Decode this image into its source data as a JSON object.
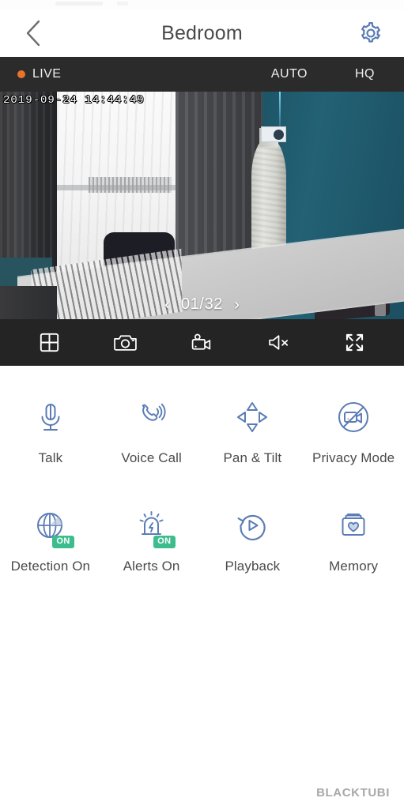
{
  "navbar": {
    "title": "Bedroom",
    "back_icon": "chevron-left-icon",
    "settings_icon": "gear-icon"
  },
  "live_bar": {
    "live_label": "LIVE",
    "status_dot_color": "#e8732a",
    "auto_label": "AUTO",
    "hq_label": "HQ"
  },
  "video": {
    "timestamp": "2019-09-24 14:44:49",
    "pager_prev": "‹",
    "pager_text": "01/32",
    "pager_next": "›"
  },
  "control_bar": {
    "items": [
      {
        "name": "grid-view-icon"
      },
      {
        "name": "snapshot-camera-icon"
      },
      {
        "name": "record-video-icon"
      },
      {
        "name": "speaker-muted-icon"
      },
      {
        "name": "fullscreen-icon"
      }
    ]
  },
  "functions": {
    "row1": [
      {
        "label": "Talk",
        "icon": "microphone-icon",
        "badge": null
      },
      {
        "label": "Voice Call",
        "icon": "phone-call-icon",
        "badge": null
      },
      {
        "label": "Pan & Tilt",
        "icon": "pan-tilt-icon",
        "badge": null
      },
      {
        "label": "Privacy Mode",
        "icon": "camera-off-icon",
        "badge": null
      }
    ],
    "row2": [
      {
        "label": "Detection On",
        "icon": "motion-detection-icon",
        "badge": "ON"
      },
      {
        "label": "Alerts On",
        "icon": "alarm-siren-icon",
        "badge": "ON"
      },
      {
        "label": "Playback",
        "icon": "playback-replay-icon",
        "badge": null
      },
      {
        "label": "Memory",
        "icon": "memory-box-icon",
        "badge": null
      }
    ]
  },
  "colors": {
    "accent_blue": "#5b7cb5",
    "badge_green": "#3dbd8e",
    "live_orange": "#e8732a",
    "bar_dark": "#2b2b2b"
  },
  "watermark": {
    "text": "BLACKTUBI"
  }
}
